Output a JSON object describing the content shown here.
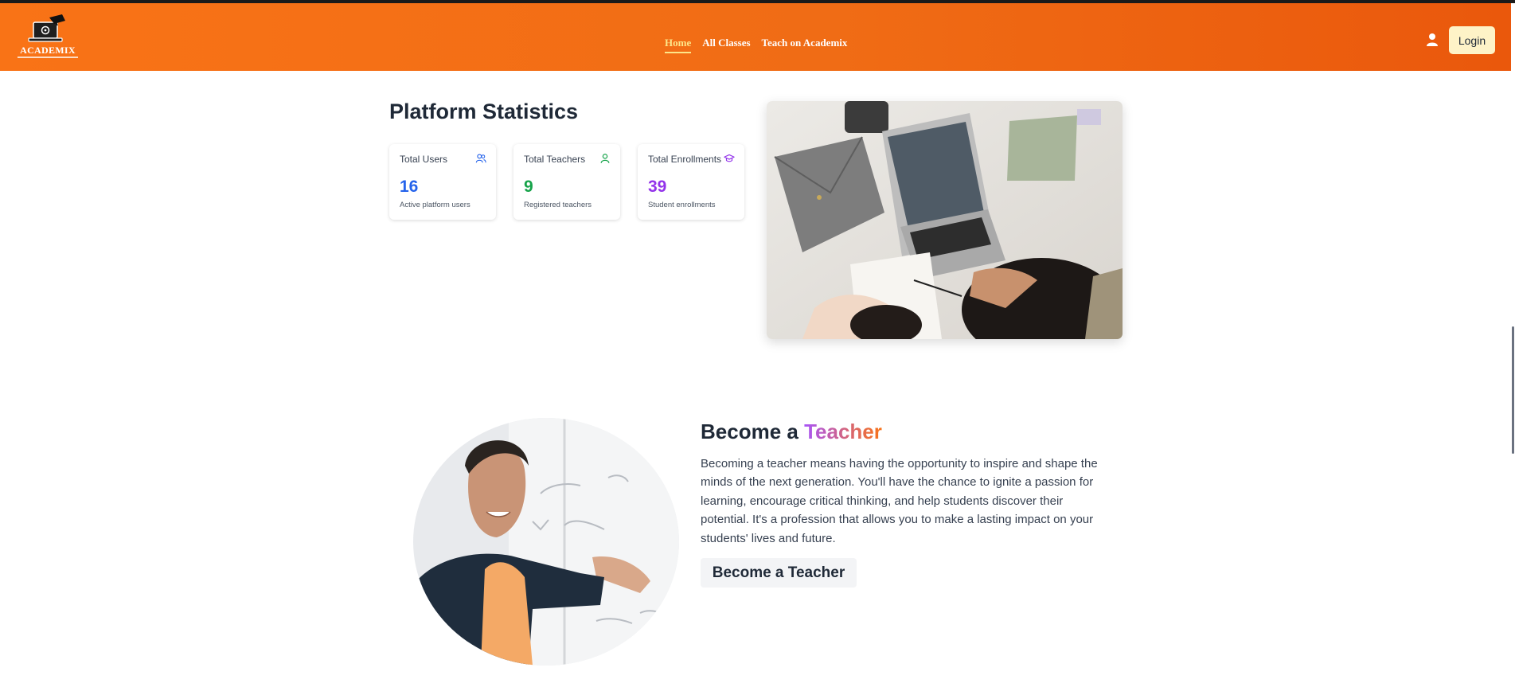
{
  "brand": {
    "name": "ACADEMIX"
  },
  "nav": {
    "links": [
      {
        "label": "Home"
      },
      {
        "label": "All Classes"
      },
      {
        "label": "Teach on Academix"
      }
    ]
  },
  "header": {
    "login_label": "Login"
  },
  "stats": {
    "title": "Platform Statistics",
    "cards": [
      {
        "label": "Total Users",
        "value": "16",
        "desc": "Active platform users",
        "color": "#2563eb",
        "icon": "users-icon"
      },
      {
        "label": "Total Teachers",
        "value": "9",
        "desc": "Registered teachers",
        "color": "#16a34a",
        "icon": "user-icon"
      },
      {
        "label": "Total Enrollments",
        "value": "39",
        "desc": "Student enrollments",
        "color": "#9333ea",
        "icon": "graduation-cap-icon"
      }
    ]
  },
  "become_teacher": {
    "title_prefix": "Become a",
    "title_accent": "Teacher",
    "text": "Becoming a teacher means having the opportunity to inspire and shape the minds of the next generation. You'll have the chance to ignite a passion for learning, encourage critical thinking, and help students discover their potential. It's a profession that allows you to make a lasting impact on your students' lives and future.",
    "button_label": "Become a Teacher"
  },
  "colors": {
    "nav_start": "#f97316",
    "nav_end": "#ea580c",
    "active_link": "#fde68a",
    "login_bg": "#fef3c7"
  }
}
